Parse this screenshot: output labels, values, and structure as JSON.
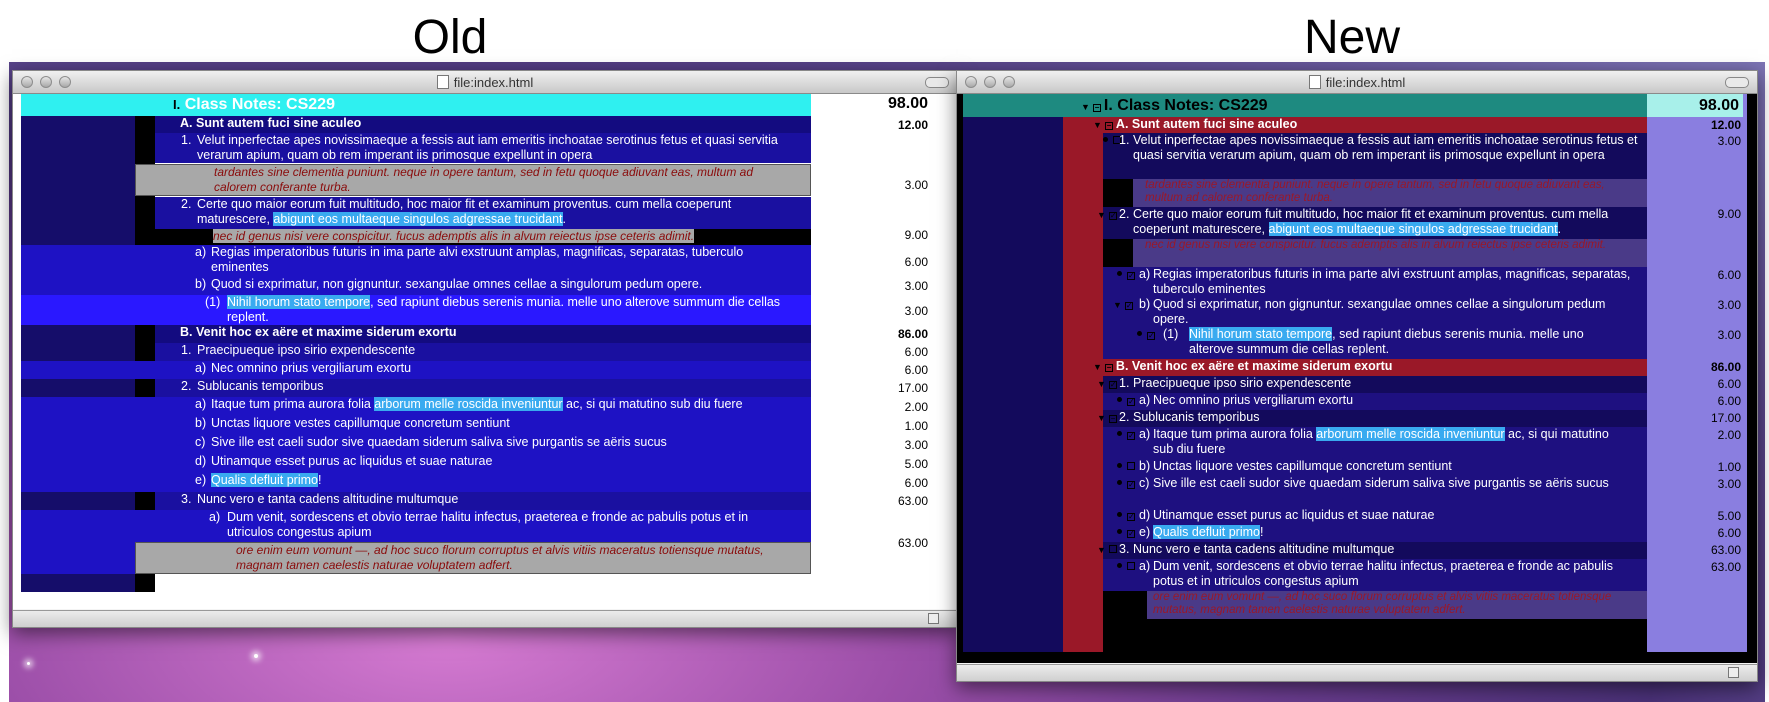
{
  "headings": {
    "old": "Old",
    "new": "New"
  },
  "old_window": {
    "title": "file:index.html"
  },
  "new_window": {
    "title": "file:index.html"
  },
  "outline": {
    "root": {
      "label": "I.",
      "text": "Class Notes: CS229",
      "value": "98.00"
    },
    "A": {
      "label": "A.",
      "text": "Sunt autem fuci sine aculeo",
      "value": "12.00"
    },
    "A1": {
      "label": "1.",
      "text": "Velut inperfectae apes novissimaeque a fessis aut iam emeritis inchoatae serotinus fetus et quasi servitia verarum apium, quam ob rem imperant iis primosque expellunt in opera",
      "value": "3.00"
    },
    "A1_note": "tardantes sine clementia puniunt. neque in opere tantum, sed in fetu quoque adiuvant eas, multum ad calorem conferante turba.",
    "A2": {
      "label": "2.",
      "text_pre": "Certe quo maior eorum fuit multitudo, hoc maior fit et examinum proventus. cum mella coeperunt maturescere, ",
      "text_hl": "abigunt eos multaeque singulos adgressae trucidant",
      "text_post": ".",
      "value": "9.00"
    },
    "A2_note": "nec id genus nisi vere conspicitur. fucus ademptis alis in alvum reiectus ipse ceteris adimit.",
    "A2a": {
      "label": "a)",
      "text": "Regias imperatoribus futuris in ima parte alvi exstruunt amplas, magnificas, separatas, tuberculo eminentes",
      "value": "6.00"
    },
    "A2b": {
      "label": "b)",
      "text": "Quod si exprimatur, non gignuntur. sexangulae omnes cellae a singulorum pedum opere.",
      "value": "3.00"
    },
    "A2b1": {
      "label": "(1)",
      "text_hl": "Nihil horum stato tempore",
      "text_post": ", sed rapiunt diebus serenis munia. melle uno alterove summum die cellas replent.",
      "value": "3.00"
    },
    "B": {
      "label": "B.",
      "text": "Venit hoc ex aëre et maxime siderum exortu",
      "value": "86.00"
    },
    "B1": {
      "label": "1.",
      "text": "Praecipueque ipso sirio expendescente",
      "value": "6.00"
    },
    "B1a": {
      "label": "a)",
      "text": "Nec omnino prius vergiliarum exortu",
      "value": "6.00"
    },
    "B2": {
      "label": "2.",
      "text": "Sublucanis temporibus",
      "value": "17.00"
    },
    "B2a": {
      "label": "a)",
      "text_pre": "Itaque tum prima aurora folia ",
      "text_hl": "arborum melle roscida inveniuntur",
      "text_post": " ac, si qui matutino sub diu fuere",
      "value": "2.00"
    },
    "B2b": {
      "label": "b)",
      "text": "Unctas liquore vestes capillumque concretum sentiunt",
      "value": "1.00"
    },
    "B2c": {
      "label": "c)",
      "text": "Sive ille est caeli sudor sive quaedam siderum saliva sive purgantis se aëris sucus",
      "value": "3.00"
    },
    "B2d": {
      "label": "d)",
      "text": "Utinamque esset purus ac liquidus et suae naturae",
      "value": "5.00"
    },
    "B2e": {
      "label": "e)",
      "text_hl": "Qualis defluit primo",
      "text_post": "!",
      "value": "6.00"
    },
    "B3": {
      "label": "3.",
      "text": "Nunc vero e tanta cadens altitudine multumque",
      "value": "63.00"
    },
    "B3a": {
      "label": "a)",
      "text": "Dum venit, sordescens et obvio terrae halitu infectus, praeterea e fronde ac pabulis potus et in utriculos congestus apium",
      "value": "63.00"
    },
    "B3a_note": "ore enim eum vomunt —, ad hoc suco florum corruptus et alvis vitiis maceratus totiensque mutatus, magnam tamen caelestis naturae voluptatem adfert."
  },
  "colors": {
    "highlight": "#39aaf0",
    "old_root": "#2ff0f0",
    "new_root": "#1e8a80",
    "new_gutter": "#9a1828",
    "new_values": "#8a7ee0"
  }
}
